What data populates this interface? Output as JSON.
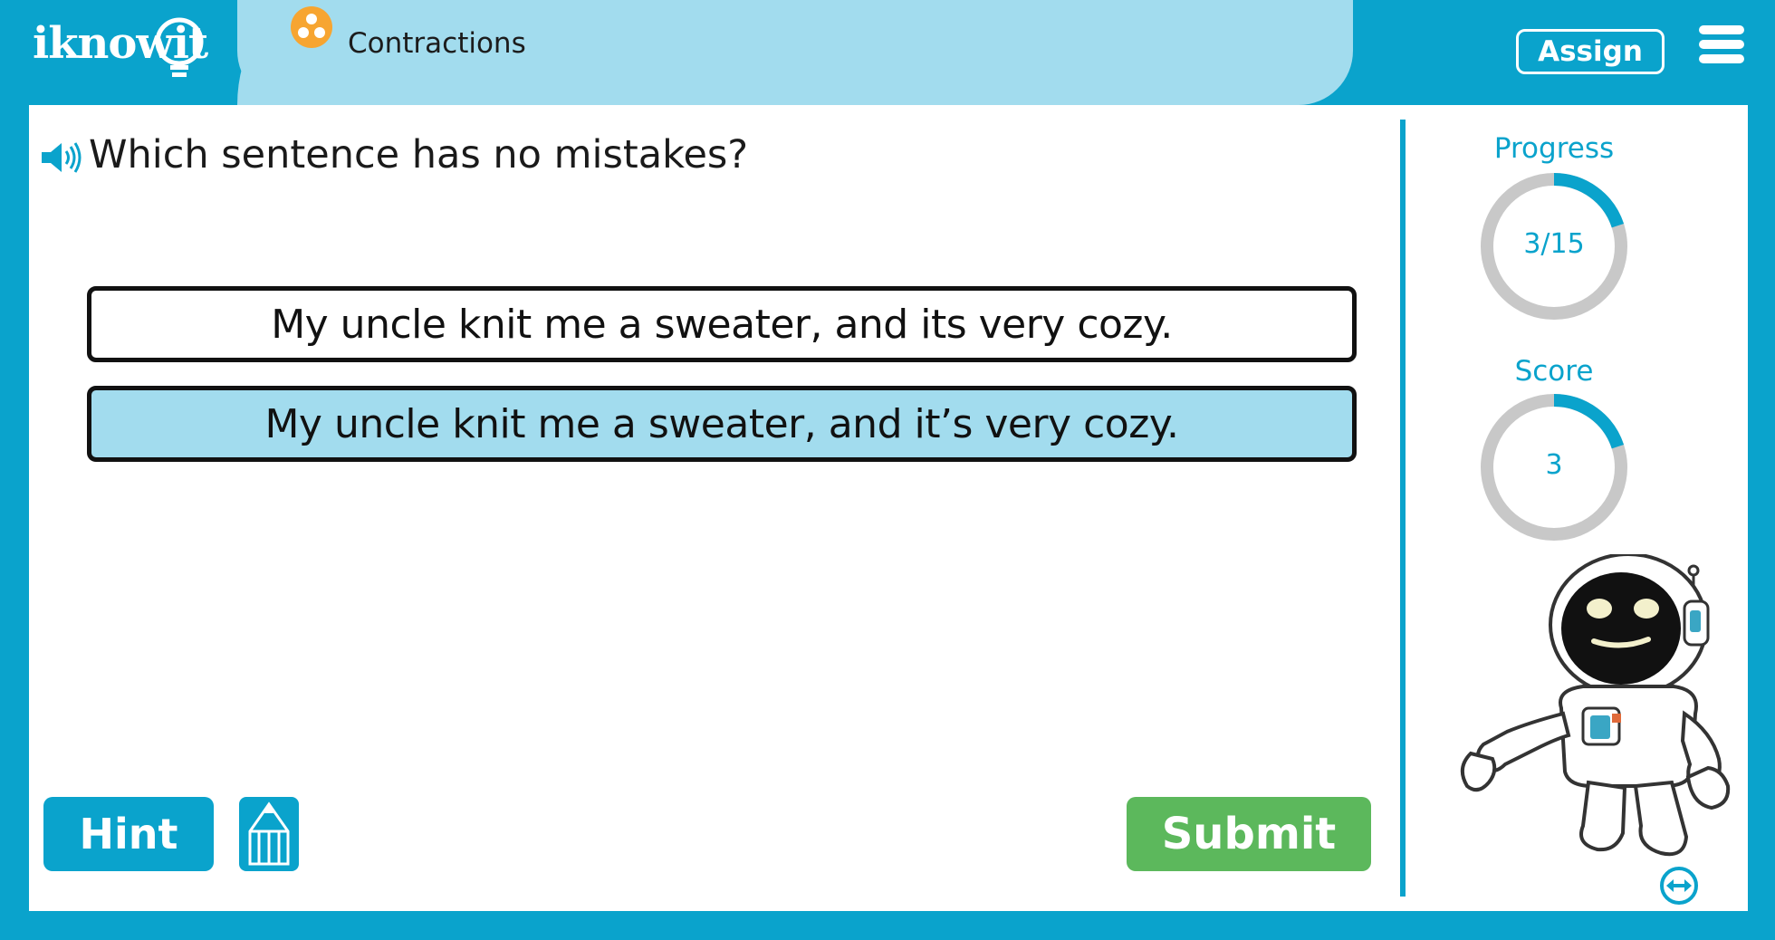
{
  "brand": {
    "name": "iknowit"
  },
  "header": {
    "topic_title": "Contractions",
    "assign_label": "Assign"
  },
  "question": {
    "text": "Which sentence has no mistakes?",
    "options": [
      {
        "text": "My uncle knit me a sweater, and its very cozy.",
        "selected": false
      },
      {
        "text": "My uncle knit me a sweater, and it’s very cozy.",
        "selected": true
      }
    ]
  },
  "buttons": {
    "hint_label": "Hint",
    "submit_label": "Submit"
  },
  "sidebar": {
    "progress_label": "Progress",
    "progress_text": "3/15",
    "progress_fraction": 0.2,
    "score_label": "Score",
    "score_text": "3",
    "score_fraction": 0.2
  },
  "colors": {
    "brand_blue": "#0aa3cc",
    "tab_light_blue": "#a2dcee",
    "submit_green": "#5cb85c",
    "topic_orange": "#f7a531",
    "ring_gray": "#c8c8c8"
  },
  "icons": {
    "topic": "topic-dots-icon",
    "speaker": "speaker-icon",
    "menu": "hamburger-menu-icon",
    "pencil": "pencil-icon",
    "expand": "expand-arrows-icon"
  }
}
